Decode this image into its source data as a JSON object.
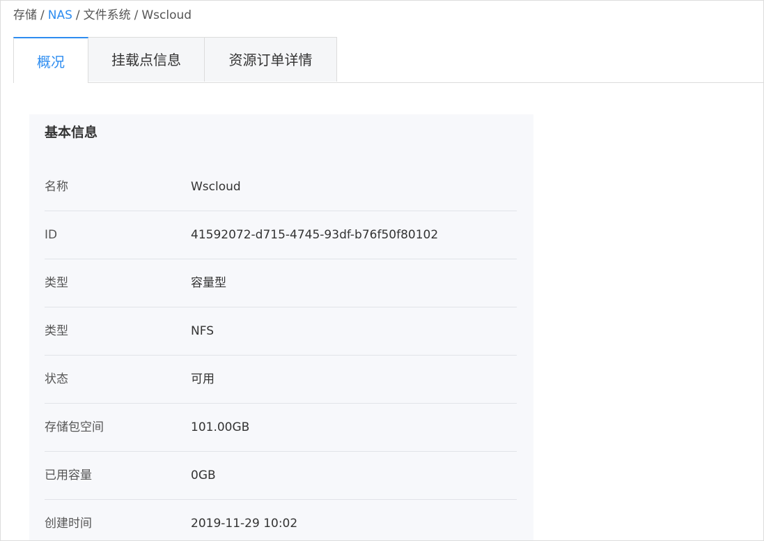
{
  "breadcrumb": {
    "items": [
      "存储",
      "NAS",
      "文件系统",
      "Wscloud"
    ],
    "separator": "/"
  },
  "tabs": [
    {
      "label": "概况",
      "active": true
    },
    {
      "label": "挂载点信息",
      "active": false
    },
    {
      "label": "资源订单详情",
      "active": false
    }
  ],
  "basic_info": {
    "title": "基本信息",
    "rows": [
      {
        "label": "名称",
        "value": "Wscloud"
      },
      {
        "label": "ID",
        "value": "41592072-d715-4745-93df-b76f50f80102"
      },
      {
        "label": "类型",
        "value": "容量型"
      },
      {
        "label": "类型",
        "value": "NFS"
      },
      {
        "label": "状态",
        "value": "可用"
      },
      {
        "label": "存储包空间",
        "value": "101.00GB"
      },
      {
        "label": "已用容量",
        "value": "0GB"
      },
      {
        "label": "创建时间",
        "value": "2019-11-29 10:02"
      }
    ]
  },
  "colors": {
    "accent": "#2d8cf0",
    "panel_bg": "#f7f8fb",
    "border": "#dcdcdc"
  }
}
